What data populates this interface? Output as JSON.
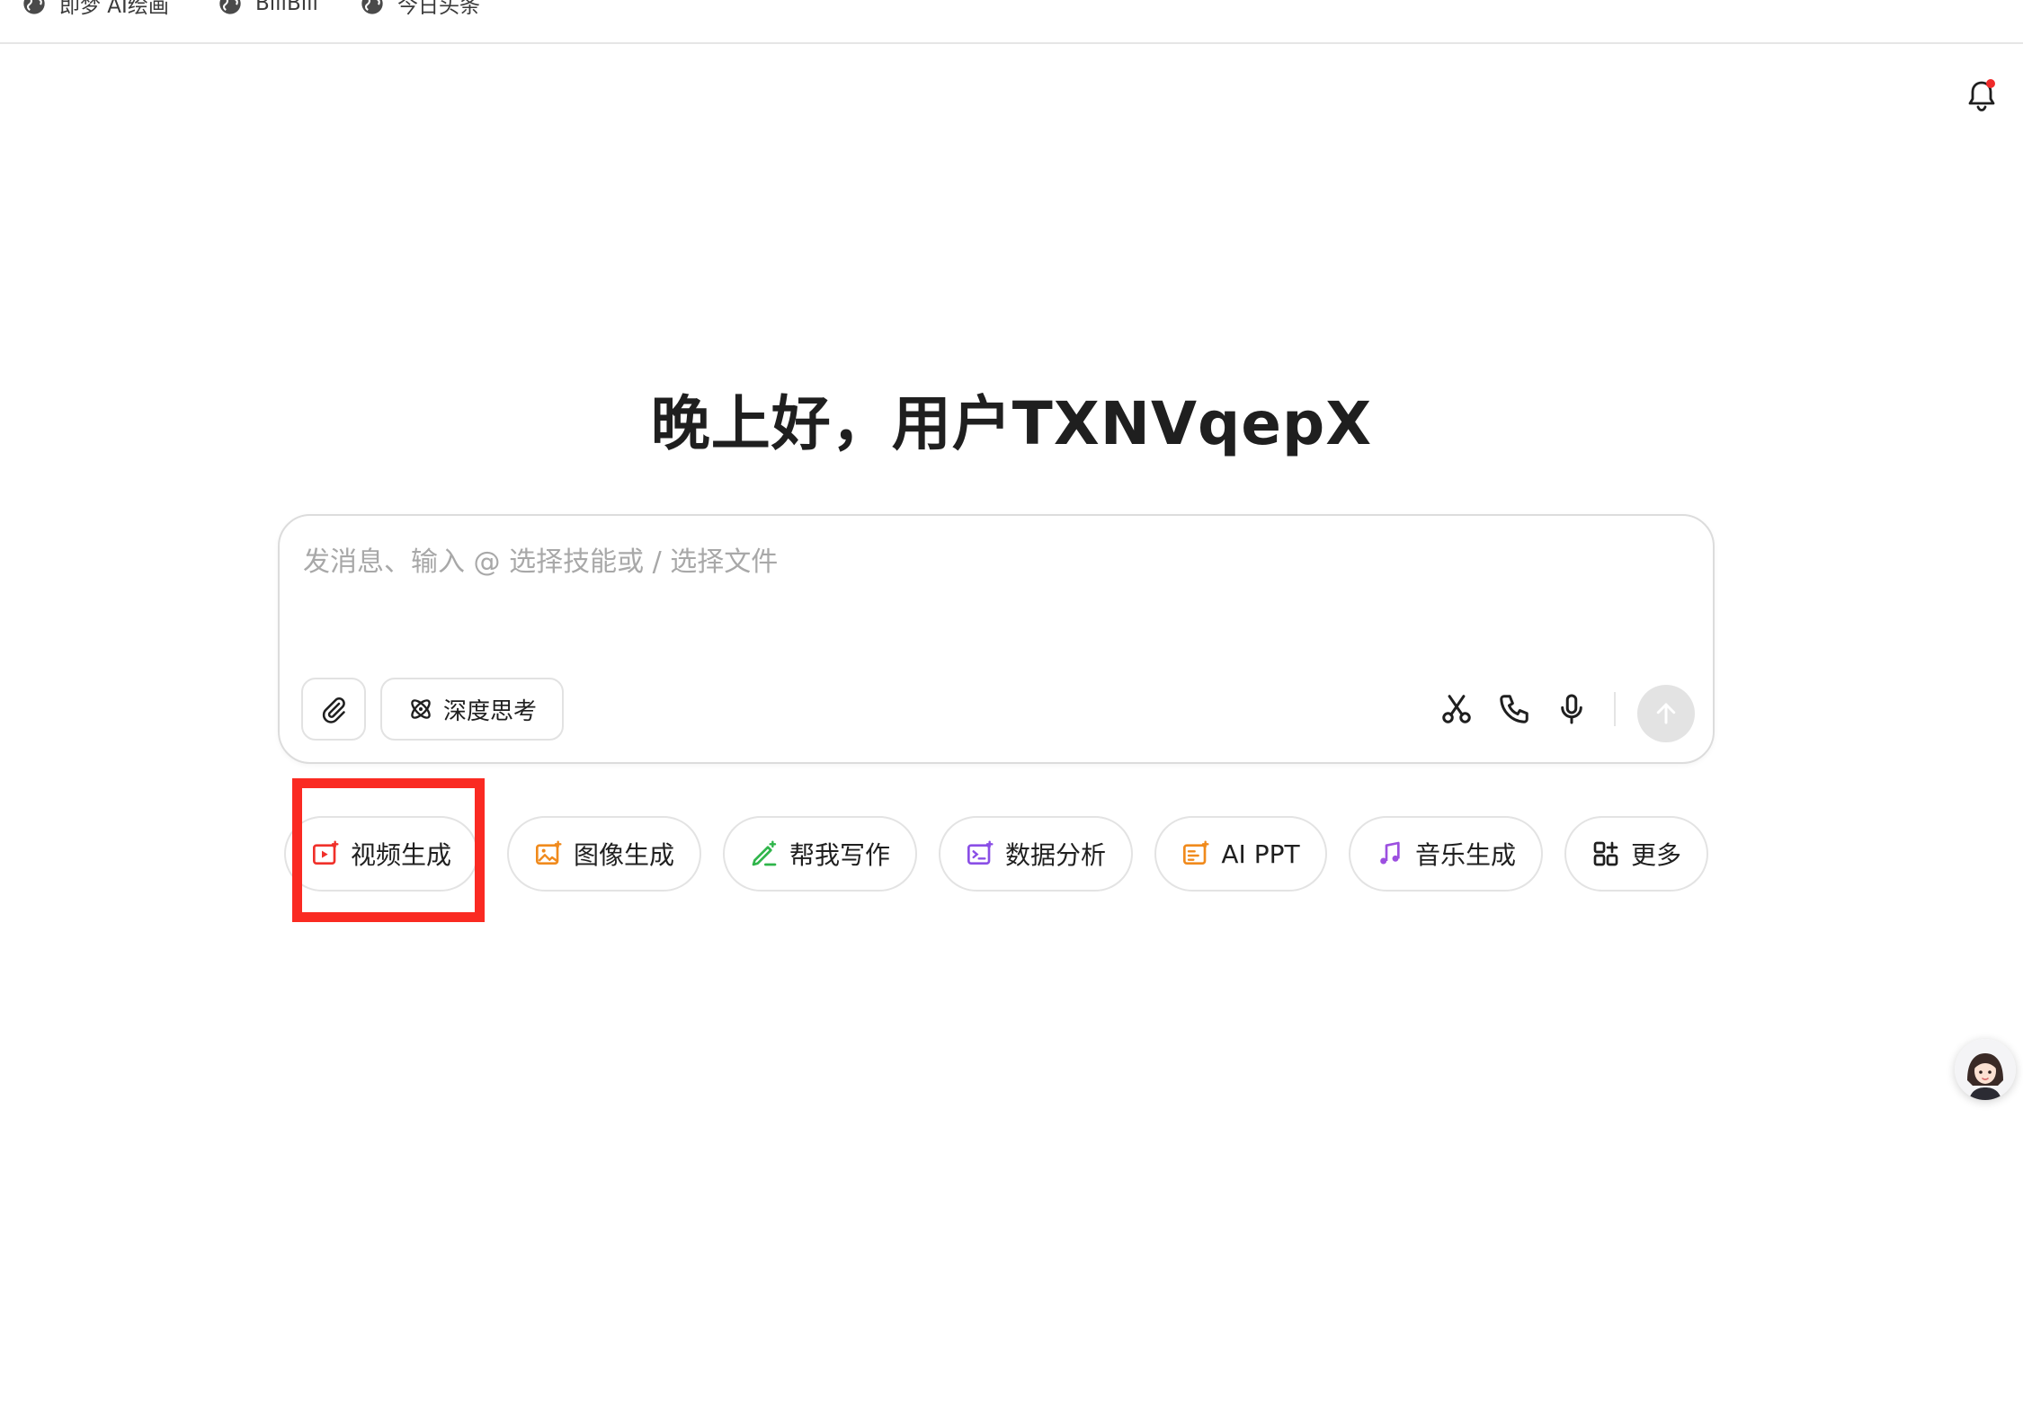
{
  "bookmarks": [
    {
      "label": "即梦 AI绘画",
      "icon": "globe-icon"
    },
    {
      "label": "BiliBili",
      "icon": "globe-icon"
    },
    {
      "label": "今日头条",
      "icon": "globe-icon"
    }
  ],
  "greeting": "晚上好，用户TXNVqepX",
  "composer": {
    "value": "",
    "placeholder": "发消息、输入 @ 选择技能或 / 选择文件",
    "deep_think_label": "深度思考"
  },
  "skills": [
    {
      "label": "视频生成",
      "icon": "video-icon",
      "color": "#f0302a"
    },
    {
      "label": "图像生成",
      "icon": "image-icon",
      "color": "#f08a1c"
    },
    {
      "label": "帮我写作",
      "icon": "pen-icon",
      "color": "#2fb54a"
    },
    {
      "label": "数据分析",
      "icon": "chart-icon",
      "color": "#8a4ee6"
    },
    {
      "label": "AI PPT",
      "icon": "slides-icon",
      "color": "#f08a1c"
    },
    {
      "label": "音乐生成",
      "icon": "music-icon",
      "color": "#9c4fe0"
    },
    {
      "label": "更多",
      "icon": "grid-icon",
      "color": "#1f1f1f"
    }
  ],
  "colors": {
    "highlight": "#fa2a22",
    "notification_dot": "#f02a2a",
    "send_button_disabled": "#e3e3e3"
  }
}
